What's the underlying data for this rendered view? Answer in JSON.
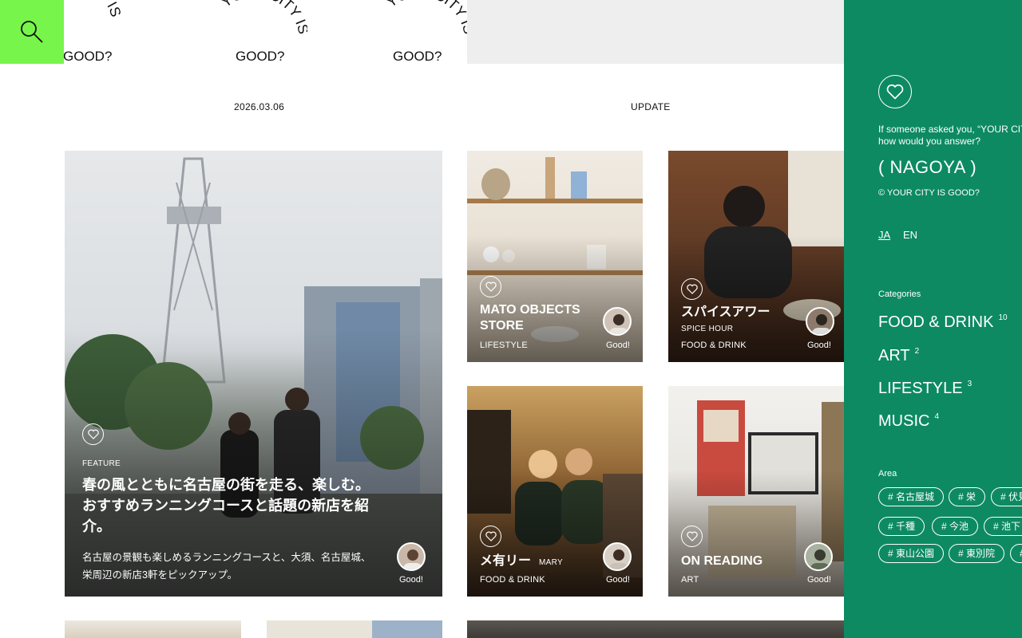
{
  "header": {
    "search_icon": "search-icon",
    "logo_lines": [
      "YOUR CITY IS",
      "GOOD?"
    ],
    "date": "2026.03.06",
    "update_label": "UPDATE"
  },
  "feature": {
    "kicker": "FEATURE",
    "title": "春の風とともに名古屋の街を走る、楽しむ。おすすめランニングコースと話題の新店を紹介。",
    "desc": "名古屋の景観も楽しめるランニングコースと、大須、名古屋城、栄周辺の新店3軒をピックアップ。",
    "good": "Good!"
  },
  "cards": [
    {
      "title": "MATO OBJECTS STORE",
      "sub": "",
      "category": "LIFESTYLE",
      "good": "Good!"
    },
    {
      "title": "スパイスアワー",
      "sub": "SPICE HOUR",
      "category": "FOOD & DRINK",
      "good": "Good!"
    },
    {
      "title": "メ有リー",
      "sub": "MARY",
      "category": "FOOD & DRINK",
      "good": "Good!"
    },
    {
      "title": "ON READING",
      "sub": "",
      "category": "ART",
      "good": "Good!"
    }
  ],
  "panel": {
    "question_1": "If someone asked you, “YOUR CITY IS GOOD?”",
    "question_2": "how would you answer?",
    "city": "( NAGOYA )",
    "copyright": "© YOUR CITY IS GOOD?",
    "lang_ja": "JA",
    "lang_en": "EN",
    "categories_label": "Categories",
    "categories": [
      {
        "name": "FOOD & DRINK",
        "count": "10"
      },
      {
        "name": "ART",
        "count": "2"
      },
      {
        "name": "LIFESTYLE",
        "count": "3"
      },
      {
        "name": "MUSIC",
        "count": "4"
      }
    ],
    "area_label": "Area",
    "areas": [
      "# 名古屋城",
      "# 栄",
      "# 伏見",
      "# 千種",
      "# 今池",
      "# 池下",
      "# 東山公園",
      "# 東別院",
      "# 大須"
    ]
  },
  "colors": {
    "accent_green": "#77f54a",
    "panel_green": "#0d8a62"
  }
}
